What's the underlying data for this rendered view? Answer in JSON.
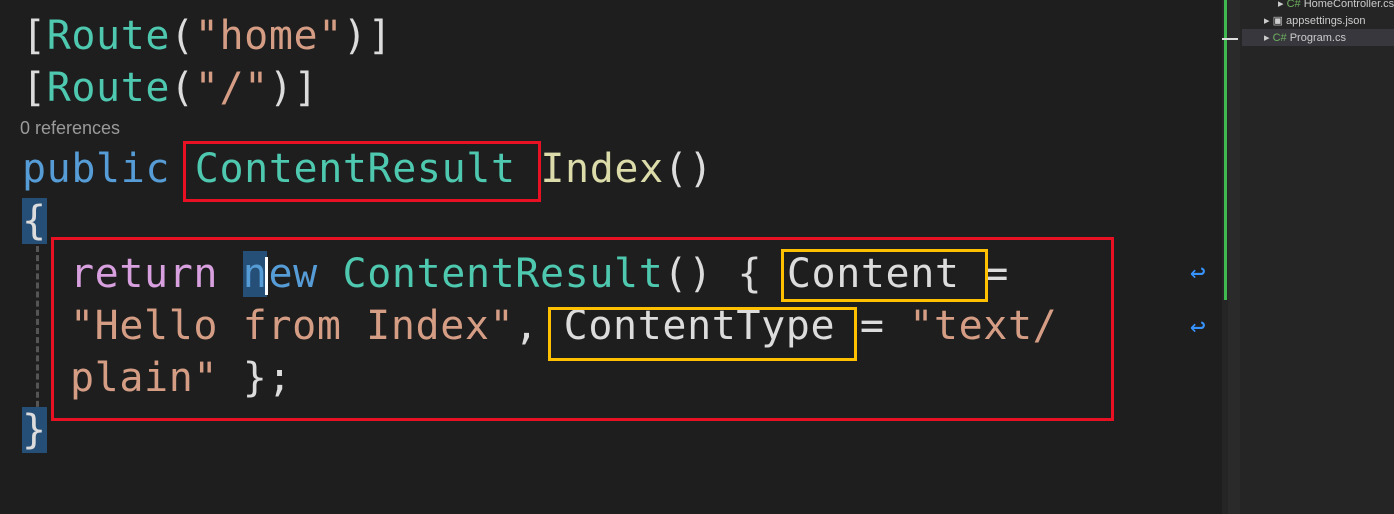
{
  "code": {
    "line1": {
      "open": "[",
      "name": "Route",
      "paren_open": "(",
      "arg": "\"home\"",
      "close": ")]"
    },
    "line2": {
      "open": "[",
      "name": "Route",
      "paren_open": "(",
      "arg": "\"/\"",
      "close": ")]"
    },
    "references": "0 references",
    "signature": {
      "modifier": "public",
      "return_type": "ContentResult",
      "method": "Index",
      "parens": "()"
    },
    "open_brace": "{",
    "body": {
      "return_kw": "return",
      "new_n": "n",
      "new_rest": "ew",
      "type": "ContentResult",
      "call": "() {",
      "content_prop": "Content",
      "eq1": "=",
      "hello": "\"Hello from Index\"",
      "comma": ",",
      "ctype_prop": "ContentType",
      "eq2": "=",
      "text": "\"text/",
      "plain": "plain\"",
      "end": "};"
    },
    "close_brace": "}"
  },
  "wrap_icon": "word-wrap-icon",
  "solution_explorer": {
    "items": [
      {
        "label": "HomeController.cs",
        "icon": "csharp-icon"
      },
      {
        "label": "appsettings.json",
        "icon": "json-icon"
      },
      {
        "label": "Program.cs",
        "icon": "csharp-icon"
      }
    ]
  },
  "colors": {
    "highlight_red": "#e81123",
    "highlight_yellow": "#ffc000"
  }
}
